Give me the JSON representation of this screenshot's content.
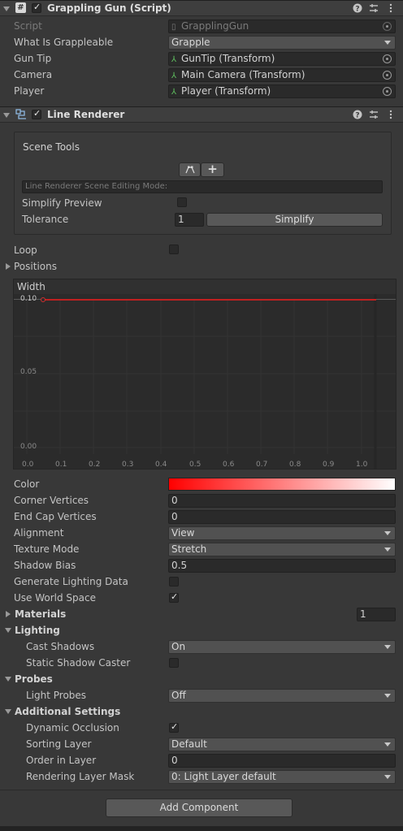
{
  "grappling_gun": {
    "title": "Grappling Gun (Script)",
    "enabled": true,
    "fields": {
      "script_label": "Script",
      "script_value": "GrapplingGun",
      "grappleable_label": "What Is Grappleable",
      "grappleable_value": "Grapple",
      "guntip_label": "Gun Tip",
      "guntip_value": "GunTip (Transform)",
      "camera_label": "Camera",
      "camera_value": "Main Camera (Transform)",
      "player_label": "Player",
      "player_value": "Player (Transform)"
    }
  },
  "line_renderer": {
    "title": "Line Renderer",
    "enabled": true,
    "scene_tools": {
      "title": "Scene Tools",
      "mode_placeholder": "Line Renderer Scene Editing Mode:",
      "simplify_preview_label": "Simplify Preview",
      "tolerance_label": "Tolerance",
      "tolerance_value": "1",
      "simplify_button": "Simplify"
    },
    "loop_label": "Loop",
    "positions_label": "Positions",
    "width_curve": {
      "title": "Width",
      "y_ticks": [
        "0.10",
        "0.05",
        "0.00"
      ],
      "x_ticks": [
        "0.0",
        "0.1",
        "0.2",
        "0.3",
        "0.4",
        "0.5",
        "0.6",
        "0.7",
        "0.8",
        "0.9",
        "1.0"
      ],
      "value": 0.1
    },
    "props": {
      "color_label": "Color",
      "corner_vertices_label": "Corner Vertices",
      "corner_vertices_value": "0",
      "end_cap_label": "End Cap Vertices",
      "end_cap_value": "0",
      "alignment_label": "Alignment",
      "alignment_value": "View",
      "texture_mode_label": "Texture Mode",
      "texture_mode_value": "Stretch",
      "shadow_bias_label": "Shadow Bias",
      "shadow_bias_value": "0.5",
      "gen_lighting_label": "Generate Lighting Data",
      "world_space_label": "Use World Space"
    },
    "materials": {
      "label": "Materials",
      "count": "1"
    },
    "lighting": {
      "label": "Lighting",
      "cast_shadows_label": "Cast Shadows",
      "cast_shadows_value": "On",
      "static_caster_label": "Static Shadow Caster"
    },
    "probes": {
      "label": "Probes",
      "light_probes_label": "Light Probes",
      "light_probes_value": "Off"
    },
    "additional": {
      "label": "Additional Settings",
      "dynamic_occlusion_label": "Dynamic Occlusion",
      "sorting_layer_label": "Sorting Layer",
      "sorting_layer_value": "Default",
      "order_label": "Order in Layer",
      "order_value": "0",
      "rendering_mask_label": "Rendering Layer Mask",
      "rendering_mask_value": "0: Light Layer default"
    }
  },
  "add_component": "Add Component",
  "colors": {
    "gradient_start": "#ff0000",
    "gradient_end": "#ffffff",
    "curve": "#c02020"
  }
}
